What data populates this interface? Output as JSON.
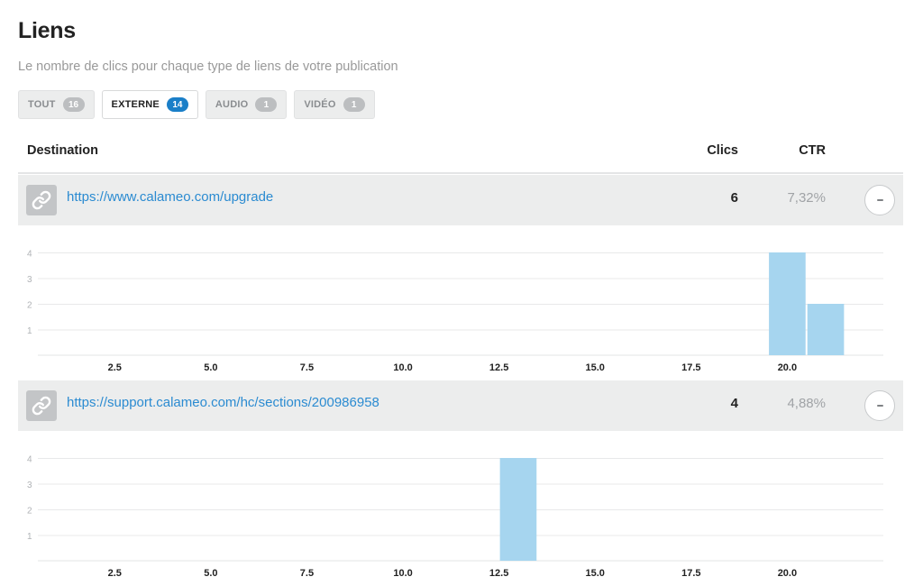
{
  "page": {
    "title": "Liens",
    "subtitle": "Le nombre de clics pour chaque type de liens de votre publication"
  },
  "filters": [
    {
      "label": "TOUT",
      "count": "16",
      "active": false
    },
    {
      "label": "EXTERNE",
      "count": "14",
      "active": true
    },
    {
      "label": "AUDIO",
      "count": "1",
      "active": false
    },
    {
      "label": "VIDÉO",
      "count": "1",
      "active": false
    }
  ],
  "table": {
    "headers": {
      "destination": "Destination",
      "clics": "Clics",
      "ctr": "CTR"
    },
    "rows": [
      {
        "url": "https://www.calameo.com/upgrade",
        "clics": "6",
        "ctr": "7,32%"
      },
      {
        "url": "https://support.calameo.com/hc/sections/200986958",
        "clics": "4",
        "ctr": "4,88%"
      }
    ]
  },
  "icons": {
    "link": "link-icon",
    "collapse": "minus-icon"
  },
  "colors": {
    "bar": "#a6d5ef",
    "link": "#2b8bd1",
    "badge_active": "#1a7fc8"
  },
  "chart_data": [
    {
      "type": "bar",
      "xticks": [
        "2.5",
        "5.0",
        "7.5",
        "10.0",
        "12.5",
        "15.0",
        "17.5",
        "20.0"
      ],
      "yticks": [
        "1",
        "2",
        "3",
        "4"
      ],
      "xlim": [
        0.5,
        22.5
      ],
      "ylim": [
        0,
        4
      ],
      "grid": true,
      "bars": [
        {
          "x": 20,
          "value": 4
        },
        {
          "x": 21,
          "value": 2
        }
      ]
    },
    {
      "type": "bar",
      "xticks": [
        "2.5",
        "5.0",
        "7.5",
        "10.0",
        "12.5",
        "15.0",
        "17.5",
        "20.0"
      ],
      "yticks": [
        "1",
        "2",
        "3",
        "4"
      ],
      "xlim": [
        0.5,
        22.5
      ],
      "ylim": [
        0,
        4
      ],
      "grid": true,
      "bars": [
        {
          "x": 13,
          "value": 4
        }
      ]
    }
  ]
}
